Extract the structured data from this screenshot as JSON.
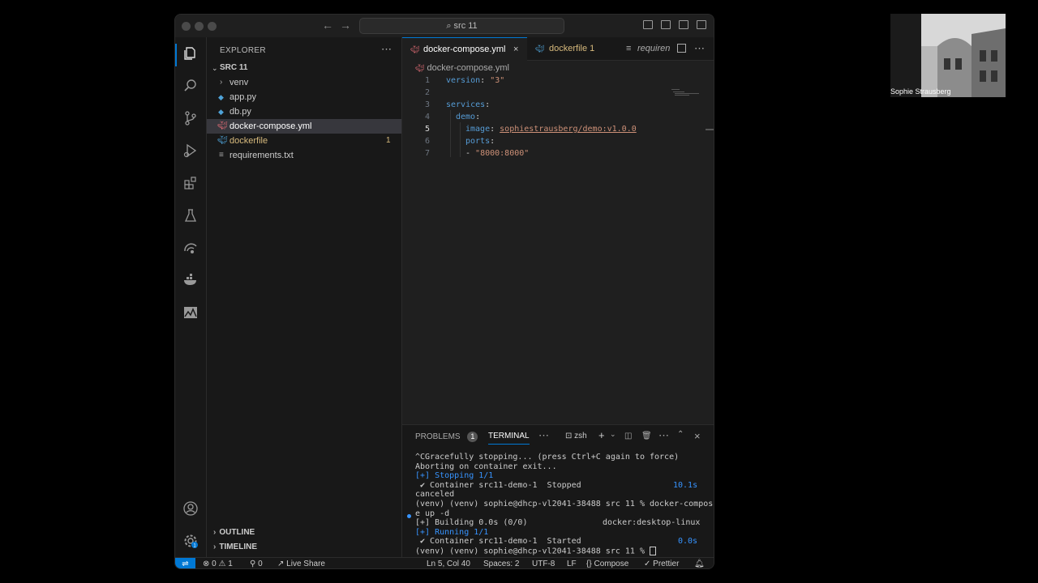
{
  "window": {
    "search_text": "src 11"
  },
  "sidebar": {
    "title": "EXPLORER",
    "folder": "SRC 11",
    "items": [
      {
        "label": "venv",
        "type": "folder"
      },
      {
        "label": "app.py",
        "type": "python"
      },
      {
        "label": "db.py",
        "type": "python"
      },
      {
        "label": "docker-compose.yml",
        "type": "yaml",
        "selected": true
      },
      {
        "label": "dockerfile",
        "type": "docker",
        "badge": "1"
      },
      {
        "label": "requirements.txt",
        "type": "text"
      }
    ],
    "outline": "OUTLINE",
    "timeline": "TIMELINE"
  },
  "editor": {
    "tabs": [
      {
        "label": "docker-compose.yml",
        "active": true
      },
      {
        "label": "dockerfile 1"
      },
      {
        "label": "requiren"
      }
    ],
    "breadcrumb": "docker-compose.yml",
    "lines": [
      {
        "n": "1",
        "key": "version",
        "value": "\"3\""
      },
      {
        "n": "2"
      },
      {
        "n": "3",
        "key": "services"
      },
      {
        "n": "4",
        "key": "demo"
      },
      {
        "n": "5",
        "key": "image",
        "value": "sophiestrausberg/demo:v1.0.0",
        "current": true
      },
      {
        "n": "6",
        "key": "ports"
      },
      {
        "n": "7",
        "value": "\"8000:8000\""
      }
    ]
  },
  "panel": {
    "problems_label": "PROBLEMS",
    "problems_count": "1",
    "terminal_label": "TERMINAL",
    "shell": "zsh",
    "terminal": [
      "^CGracefully stopping... (press Ctrl+C again to force)",
      "Aborting on container exit...",
      "[+] Stopping 1/1",
      " ✔ Container src11-demo-1  Stopped",
      "canceled",
      "(venv) (venv) sophie@dhcp-vl2041-38488 src 11 % docker-compos",
      "e up -d",
      "[+] Building 0.0s (0/0)",
      "[+] Running 1/1",
      " ✔ Container src11-demo-1  Started",
      "(venv) (venv) sophie@dhcp-vl2041-38488 src 11 % "
    ],
    "stop_time": "10.1s",
    "build_context": "docker:desktop-linux",
    "start_time": "0.0s"
  },
  "status": {
    "errors": "0",
    "warnings": "1",
    "ports": "0",
    "live_share": "Live Share",
    "position": "Ln 5, Col 40",
    "spaces": "Spaces: 2",
    "encoding": "UTF-8",
    "eol": "LF",
    "language": "Compose",
    "formatter": "Prettier"
  },
  "participant": {
    "name": "Sophie Strausberg"
  }
}
